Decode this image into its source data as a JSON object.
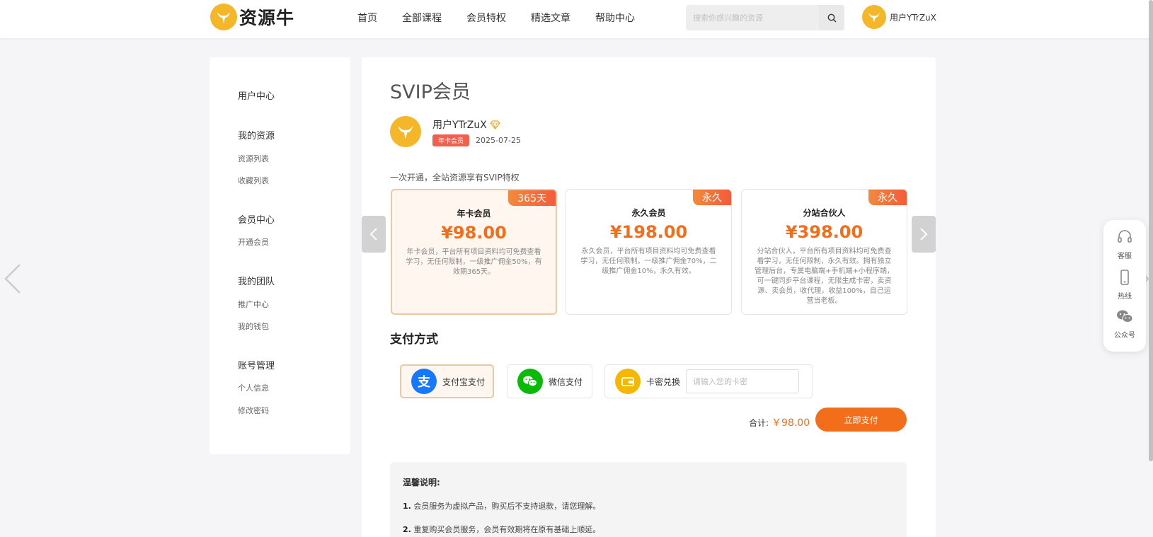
{
  "header": {
    "logo_text": "资源牛",
    "nav": [
      "首页",
      "全部课程",
      "会员特权",
      "精选文章",
      "帮助中心"
    ],
    "search_placeholder": "搜索你感兴趣的资源",
    "user_name": "用户YTrZuX"
  },
  "sidebar": {
    "title": "用户中心",
    "groups": [
      {
        "label": "我的资源",
        "items": [
          "资源列表",
          "收藏列表"
        ]
      },
      {
        "label": "会员中心",
        "items": [
          "开通会员"
        ]
      },
      {
        "label": "我的团队",
        "items": [
          "推广中心",
          "我的钱包"
        ]
      },
      {
        "label": "账号管理",
        "items": [
          "个人信息",
          "修改密码"
        ]
      }
    ]
  },
  "main": {
    "title": "SVIP会员",
    "profile": {
      "name": "用户YTrZuX",
      "badge": "年卡会员",
      "date": "2025-07-25"
    },
    "intro": "一次开通，全站资源享有SVIP特权",
    "plans": [
      {
        "tag": "365天",
        "name": "年卡会员",
        "price": "¥98.00",
        "desc": "年卡会员，平台所有项目资料均可免费查看学习，无任何限制，一级推广佣金50%，有效期365天。"
      },
      {
        "tag": "永久",
        "name": "永久会员",
        "price": "¥198.00",
        "desc": "永久会员，平台所有项目资料均可免费查看学习，无任何限制，一级推广佣金70%，二级推广佣金10%，永久有效。"
      },
      {
        "tag": "永久",
        "name": "分站合伙人",
        "price": "¥398.00",
        "desc": "分站合伙人，平台所有项目资料均可免费查看学习，无任何限制，永久有效。拥有独立管理后台，专属电脑端+手机端+小程序端，可一键同步平台课程，无限生成卡密，卖资源、卖会员，收代理，收益100%，自己运营当老板。"
      }
    ],
    "payment": {
      "title": "支付方式",
      "alipay": "支付宝支付",
      "wechat": "微信支付",
      "card": "卡密兑换",
      "card_placeholder": "请输入您的卡密"
    },
    "total_label": "合计:",
    "total_amount": "￥98.00",
    "pay_button": "立即支付",
    "notice": {
      "title": "温馨说明:",
      "items": [
        {
          "num": "1.",
          "text": "会员服务为虚拟产品，购买后不支持退款，请您理解。"
        },
        {
          "num": "2.",
          "text": "重复购买会员服务，会员有效期将在原有基础上顺延。"
        }
      ]
    }
  },
  "float_panel": [
    "客服",
    "热线",
    "公众号"
  ],
  "colors": {
    "accent": "#f26e1a",
    "brand": "#f5b72a",
    "badge": "#f2604d"
  }
}
